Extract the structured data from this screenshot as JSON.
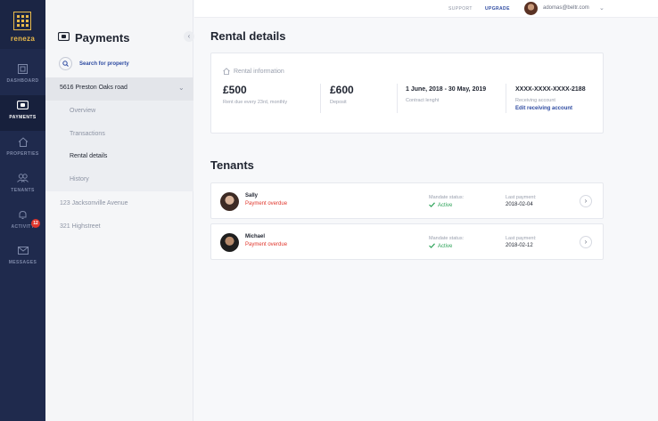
{
  "brand": {
    "name": "reneza",
    "accent": "#e8b94a"
  },
  "nav": [
    {
      "label": "DASHBOARD",
      "icon": "dashboard-icon"
    },
    {
      "label": "PAYMENTS",
      "icon": "payments-icon",
      "active": true
    },
    {
      "label": "PROPERTIES",
      "icon": "home-icon"
    },
    {
      "label": "TENANTS",
      "icon": "users-icon"
    },
    {
      "label": "ACTIVITY",
      "icon": "bell-icon",
      "badge": "12"
    },
    {
      "label": "MESSAGES",
      "icon": "mail-icon"
    }
  ],
  "sidebar": {
    "title": "Payments",
    "search_label": "Search for property",
    "active_property": "5616 Preston Oaks road",
    "subitems": [
      "Overview",
      "Transactions",
      "Rental details",
      "History"
    ],
    "selected_subitem": "Rental details",
    "other_properties": [
      "123 Jacksonville Avenue",
      "321 Highstreet"
    ]
  },
  "topbar": {
    "support": "SUPPORT",
    "upgrade": "UPGRADE",
    "email": "adomas@beltr.com"
  },
  "rental": {
    "heading": "Rental details",
    "card_title": "Rental information",
    "rent_value": "£500",
    "rent_sub": "Rent due every 23rd, monthly",
    "deposit_value": "£600",
    "deposit_sub": "Deposit",
    "contract_value": "1 June, 2018 - 30 May, 2019",
    "contract_sub": "Contract lenght",
    "account_value": "XXXX-XXXX-XXXX-2188",
    "account_sub": "Receiving account",
    "account_link": "Edit receiving account"
  },
  "tenants": {
    "heading": "Tenants",
    "mandate_label": "Mandate status:",
    "last_payment_label": "Last payment:",
    "items": [
      {
        "name": "Sally",
        "status": "Payment overdue",
        "mandate": "Active",
        "last_payment": "2018-02-04"
      },
      {
        "name": "Michael",
        "status": "Payment overdue",
        "mandate": "Active",
        "last_payment": "2018-02-12"
      }
    ]
  }
}
